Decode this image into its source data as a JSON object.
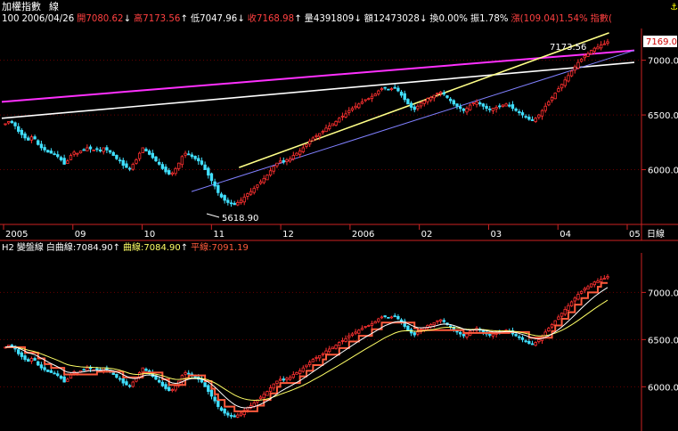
{
  "title": "加權指數",
  "period": "線",
  "info_row": [
    {
      "text": "100",
      "color": "#ffffff"
    },
    {
      "text": "2006/04/26",
      "color": "#ffffff"
    },
    {
      "text": "開7080.62",
      "color": "#ff4040"
    },
    {
      "text": "↓",
      "color": "#ffffff"
    },
    {
      "text": "高7173.56",
      "color": "#ff4040"
    },
    {
      "text": "↑",
      "color": "#ffffff"
    },
    {
      "text": "低7047.96",
      "color": "#ffffff"
    },
    {
      "text": "↓",
      "color": "#ffffff"
    },
    {
      "text": "收7168.98",
      "color": "#ff4040"
    },
    {
      "text": "↑",
      "color": "#ffffff"
    },
    {
      "text": "量4391809",
      "color": "#ffffff"
    },
    {
      "text": "↓",
      "color": "#ffffff"
    },
    {
      "text": "額12473028",
      "color": "#ffffff"
    },
    {
      "text": "↓",
      "color": "#ffffff"
    },
    {
      "text": "換0.00%",
      "color": "#ffffff"
    },
    {
      "text": "振1.78%",
      "color": "#ffffff"
    },
    {
      "text": "漲(109.04)1.54%",
      "color": "#ff4040"
    },
    {
      "text": "指數(",
      "color": "#ff4040"
    }
  ],
  "panel2_header": [
    {
      "text": "H2",
      "color": "#ffffff"
    },
    {
      "text": "變盤線",
      "color": "#ffffff"
    },
    {
      "text": "白曲線:7084.90",
      "color": "#ffffff"
    },
    {
      "text": "↑",
      "color": "#ffffff"
    },
    {
      "text": "曲線:7084.90",
      "color": "#ffff66"
    },
    {
      "text": "↑",
      "color": "#ffffff"
    },
    {
      "text": "平線:7091.19",
      "color": "#ff5a3c"
    }
  ],
  "chart_data": [
    {
      "type": "candlestick",
      "panel": "price",
      "y_ticks": [
        "7000.0",
        "6500.0",
        "6000.0"
      ],
      "ylim": [
        5500,
        7290
      ],
      "current_price_label": "7169.0",
      "annotations": {
        "high_label": "7173.56",
        "low_label": "5618.90"
      },
      "x_ticks": [
        "2005",
        "09",
        "10",
        "11",
        "12",
        "2006",
        "02",
        "03",
        "04",
        "05"
      ],
      "x_unit": "日線",
      "trendlines": [
        {
          "name": "magenta",
          "color": "#ff30ff",
          "from": [
            0,
            6620
          ],
          "to": [
            1,
            7090
          ]
        },
        {
          "name": "white",
          "color": "#ffffff",
          "from": [
            0,
            6470
          ],
          "to": [
            1,
            6980
          ]
        },
        {
          "name": "yellow",
          "color": "#ffff88",
          "from": [
            0.375,
            6020
          ],
          "to": [
            0.96,
            7250
          ]
        },
        {
          "name": "blue",
          "color": "#8080ff",
          "from": [
            0.3,
            5800
          ],
          "to": [
            1,
            7090
          ]
        }
      ],
      "closes": [
        6420,
        6440,
        6430,
        6400,
        6350,
        6320,
        6290,
        6270,
        6300,
        6280,
        6230,
        6200,
        6180,
        6160,
        6150,
        6140,
        6120,
        6090,
        6050,
        6080,
        6130,
        6160,
        6150,
        6170,
        6180,
        6200,
        6190,
        6180,
        6190,
        6170,
        6200,
        6180,
        6160,
        6130,
        6100,
        6080,
        6040,
        6020,
        6010,
        6050,
        6090,
        6150,
        6200,
        6170,
        6140,
        6110,
        6080,
        6050,
        6010,
        5980,
        5960,
        5970,
        6010,
        6060,
        6120,
        6150,
        6140,
        6120,
        6100,
        6080,
        6050,
        6000,
        5950,
        5900,
        5850,
        5790,
        5750,
        5720,
        5700,
        5690,
        5680,
        5700,
        5720,
        5750,
        5780,
        5800,
        5830,
        5860,
        5890,
        5920,
        5950,
        5990,
        6030,
        6060,
        6080,
        6070,
        6090,
        6100,
        6130,
        6150,
        6170,
        6200,
        6230,
        6260,
        6290,
        6310,
        6330,
        6350,
        6380,
        6400,
        6420,
        6440,
        6470,
        6490,
        6510,
        6540,
        6560,
        6580,
        6600,
        6620,
        6640,
        6650,
        6670,
        6690,
        6720,
        6740,
        6750,
        6730,
        6740,
        6750,
        6720,
        6680,
        6640,
        6600,
        6570,
        6550,
        6580,
        6610,
        6630,
        6650,
        6660,
        6680,
        6700,
        6710,
        6690,
        6660,
        6630,
        6600,
        6580,
        6560,
        6540,
        6560,
        6590,
        6610,
        6620,
        6600,
        6580,
        6560,
        6550,
        6560,
        6570,
        6580,
        6590,
        6600,
        6580,
        6560,
        6540,
        6520,
        6500,
        6480,
        6460,
        6450,
        6470,
        6500,
        6540,
        6580,
        6620,
        6660,
        6700,
        6740,
        6780,
        6820,
        6860,
        6900,
        6940,
        6980,
        7010,
        7040,
        7060,
        7090,
        7110,
        7120,
        7140,
        7150,
        7169
      ]
    },
    {
      "type": "line",
      "panel": "indicator",
      "y_ticks": [
        "7000.0",
        "6500.0",
        "6000.0"
      ],
      "ylim": [
        5550,
        7400
      ],
      "series": [
        {
          "name": "白曲線",
          "color": "#ffffff"
        },
        {
          "name": "曲線",
          "color": "#ffff66"
        },
        {
          "name": "平線",
          "color": "#ff5a3c"
        }
      ]
    }
  ]
}
